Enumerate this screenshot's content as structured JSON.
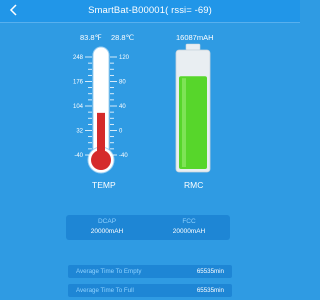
{
  "header": {
    "title": "SmartBat-B00001( rssi= -69)"
  },
  "temperature": {
    "fahrenheit_text": "83.8℉",
    "celsius_text": "28.8℃",
    "fahrenheit_ticks": [
      "248",
      "176",
      "104",
      "32",
      "-40"
    ],
    "celsius_ticks": [
      "120",
      "80",
      "40",
      "0",
      "-40"
    ],
    "celsius_value": 28.8,
    "celsius_min": -40,
    "celsius_max": 120,
    "caption": "TEMP"
  },
  "battery": {
    "capacity_text": "16087mAH",
    "fill_fraction": 0.8,
    "caption": "RMC"
  },
  "capacity_panel": {
    "dcap_label": "DCAP",
    "dcap_value": "20000mAH",
    "fcc_label": "FCC",
    "fcc_value": "20000mAH"
  },
  "times": [
    {
      "label": "Average Time To Empty",
      "value": "65535min"
    },
    {
      "label": "Average Time To Full",
      "value": "65535min"
    }
  ],
  "colors": {
    "background": "#2f9be3",
    "mercury": "#d52b2b",
    "battery_fill": "#57d62b",
    "accent_text": "#8fd2ff"
  }
}
